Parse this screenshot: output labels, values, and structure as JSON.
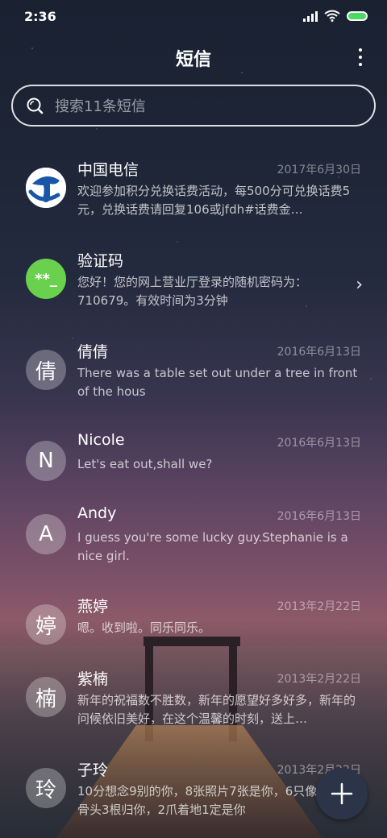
{
  "status": {
    "time": "2:36"
  },
  "header": {
    "title": "短信"
  },
  "search": {
    "placeholder": "搜索11条短信"
  },
  "messages": [
    {
      "name": "中国电信",
      "date": "2017年6月30日",
      "preview": "欢迎参加积分兑换话费活动，每500分可兑换话费5元，兑换话费请回复106或jfdh#话费金…",
      "avatar": "telecom-logo"
    },
    {
      "name": "验证码",
      "date": "",
      "preview": "您好！您的网上营业厅登录的随机密码为：710679。有效时间为3分钟",
      "avatar_text": "**_"
    },
    {
      "name": "倩倩",
      "date": "2016年6月13日",
      "preview": "There was a table set out under a tree in front of the hous",
      "avatar_text": "倩"
    },
    {
      "name": "Nicole",
      "date": "2016年6月13日",
      "preview": "Let's eat out,shall we?",
      "avatar_text": "N"
    },
    {
      "name": "Andy",
      "date": "2016年6月13日",
      "preview": "I guess you're some lucky guy.Stephanie is a nice girl.",
      "avatar_text": "A"
    },
    {
      "name": "燕婷",
      "date": "2013年2月22日",
      "preview": "嗯。收到啦。同乐同乐。",
      "avatar_text": "婷"
    },
    {
      "name": "紫楠",
      "date": "2013年2月22日",
      "preview": "新年的祝福数不胜数，新年的愿望好多好多，新年的问候依旧美好，在这个温馨的时刻，送上…",
      "avatar_text": "楠"
    },
    {
      "name": "子玲",
      "date": "2013年2月22日",
      "preview": "10分想念9别的你，8张照片7张是你，6只像你，4根骨头3根归你，2爪着地1定是你",
      "avatar_text": "玲"
    }
  ],
  "colors": {
    "code_avatar": "#6ad14e",
    "telecom_blue": "#1a56a8",
    "fab": "#2b3448"
  }
}
